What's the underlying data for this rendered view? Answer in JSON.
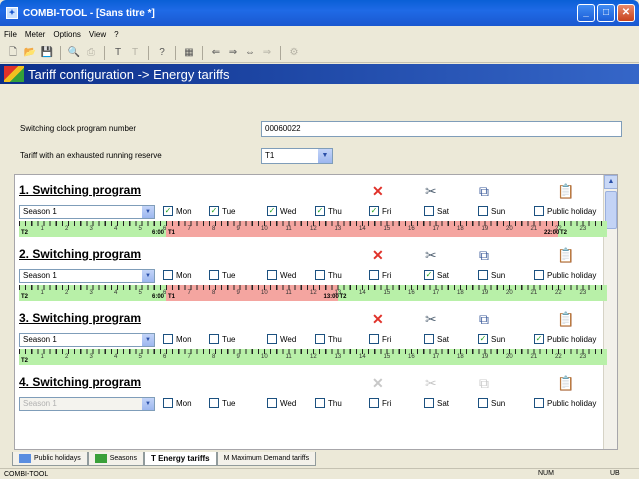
{
  "window": {
    "title": "COMBI-TOOL - [Sans titre *]",
    "controls": [
      "_",
      "□",
      "✕"
    ]
  },
  "menu": [
    "File",
    "Meter",
    "Options",
    "View",
    "?"
  ],
  "header": {
    "title": "Tariff configuration -> Energy tariffs"
  },
  "form": {
    "program_number_label": "Switching clock program number",
    "program_number_value": "00060022",
    "exhausted_label": "Tariff with an exhausted running reserve",
    "exhausted_value": "T1"
  },
  "day_labels": [
    "Mon",
    "Tue",
    "Wed",
    "Thu",
    "Fri",
    "Sat",
    "Sun",
    "Public holiday"
  ],
  "hours": [
    "1",
    "2",
    "3",
    "4",
    "5",
    "6",
    "7",
    "8",
    "9",
    "10",
    "11",
    "12",
    "13",
    "14",
    "15",
    "16",
    "17",
    "18",
    "19",
    "20",
    "21",
    "22",
    "23"
  ],
  "programs": [
    {
      "title": "1. Switching program",
      "season": "Season 1",
      "enabled": true,
      "days": [
        true,
        true,
        true,
        true,
        true,
        false,
        false,
        false
      ],
      "segments": [
        {
          "tariff": "T2",
          "from": 0,
          "to": 6.0,
          "color": "#b8f0a8"
        },
        {
          "tariff": "T1",
          "from": 6.0,
          "to": 22.0,
          "color": "#f4a5a0"
        },
        {
          "tariff": "T2",
          "from": 22.0,
          "to": 24,
          "color": "#b8f0a8"
        }
      ],
      "labels": [
        {
          "text": "T2",
          "at": 0
        },
        {
          "text": "6:00",
          "at": 6.0
        },
        {
          "text": "T1",
          "at": 6.0
        },
        {
          "text": "22:00",
          "at": 22.0
        },
        {
          "text": "T2",
          "at": 22.0
        }
      ]
    },
    {
      "title": "2. Switching program",
      "season": "Season 1",
      "enabled": true,
      "days": [
        false,
        false,
        false,
        false,
        false,
        true,
        false,
        false
      ],
      "segments": [
        {
          "tariff": "T2",
          "from": 0,
          "to": 6.0,
          "color": "#b8f0a8"
        },
        {
          "tariff": "T1",
          "from": 6.0,
          "to": 13.0,
          "color": "#f4a5a0"
        },
        {
          "tariff": "T2",
          "from": 13.0,
          "to": 24,
          "color": "#b8f0a8"
        }
      ],
      "labels": [
        {
          "text": "T2",
          "at": 0
        },
        {
          "text": "6:00",
          "at": 6.0
        },
        {
          "text": "T1",
          "at": 6.0
        },
        {
          "text": "13:00",
          "at": 13.0
        },
        {
          "text": "T2",
          "at": 13.0
        }
      ]
    },
    {
      "title": "3. Switching program",
      "season": "Season 1",
      "enabled": true,
      "days": [
        false,
        false,
        false,
        false,
        false,
        false,
        true,
        true
      ],
      "segments": [
        {
          "tariff": "T2",
          "from": 0,
          "to": 24,
          "color": "#b8f0a8"
        }
      ],
      "labels": [
        {
          "text": "T2",
          "at": 0
        }
      ]
    },
    {
      "title": "4. Switching program",
      "season": "Season 1",
      "enabled": false,
      "days": [
        false,
        false,
        false,
        false,
        false,
        false,
        false,
        false
      ],
      "segments": [],
      "labels": []
    }
  ],
  "tabs": [
    {
      "label": "Public holidays",
      "active": false
    },
    {
      "label": "Seasons",
      "active": false
    },
    {
      "label": "T Energy tariffs",
      "active": true
    },
    {
      "label": "M Maximum Demand tariffs",
      "active": false
    }
  ],
  "status": {
    "left": "COMBI-TOOL",
    "num": "NUM",
    "lang": "UB"
  }
}
